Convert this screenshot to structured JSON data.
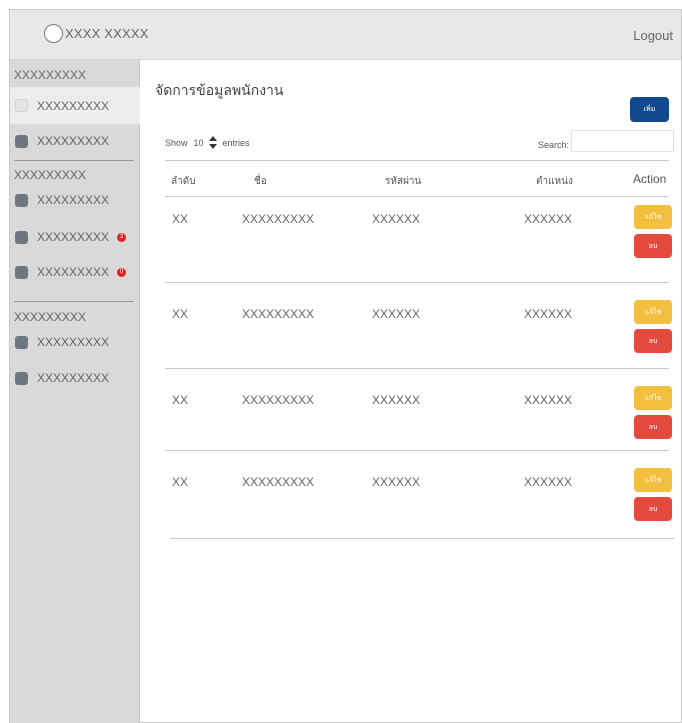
{
  "header": {
    "brand_text": "XXXX XXXXX",
    "logout_label": "Logout"
  },
  "sidebar": {
    "sections": [
      {
        "heading": "XXXXXXXXX",
        "items": [
          {
            "label": "XXXXXXXXX",
            "active": true
          },
          {
            "label": "XXXXXXXXX"
          }
        ]
      },
      {
        "heading": "XXXXXXXXX",
        "items": [
          {
            "label": "XXXXXXXXX"
          },
          {
            "label": "XXXXXXXXX",
            "badge": "3"
          },
          {
            "label": "XXXXXXXXX",
            "badge": "0"
          }
        ]
      },
      {
        "heading": "XXXXXXXXX",
        "items": [
          {
            "label": "XXXXXXXXX"
          },
          {
            "label": "XXXXXXXXX"
          }
        ]
      }
    ]
  },
  "main": {
    "title": "จัดการข้อมูลพนักงาน",
    "add_label": "เพิ่ม",
    "show_label": "Show",
    "show_value": "10",
    "entries_label": "entries",
    "search_label": "Search:",
    "search_value": "",
    "columns": [
      "ลำดับ",
      "ชื่อ",
      "รหัสผ่าน",
      "ตำแหน่ง",
      "Action"
    ],
    "rows": [
      {
        "no": "XX",
        "name": "XXXXXXXXX",
        "password": "XXXXXX",
        "position": "XXXXXX"
      },
      {
        "no": "XX",
        "name": "XXXXXXXXX",
        "password": "XXXXXX",
        "position": "XXXXXX"
      },
      {
        "no": "XX",
        "name": "XXXXXXXXX",
        "password": "XXXXXX",
        "position": "XXXXXX"
      },
      {
        "no": "XX",
        "name": "XXXXXXXXX",
        "password": "XXXXXX",
        "position": "XXXXXX"
      }
    ],
    "edit_label": "แก้ไข",
    "delete_label": "ลบ"
  },
  "colors": {
    "add_button": "#12498c",
    "edit_button": "#f2bf3f",
    "delete_button": "#e4493d",
    "badge": "#e62222",
    "sidebar_bg": "#d9d9d9",
    "topbar_bg": "#e8e8e8"
  }
}
